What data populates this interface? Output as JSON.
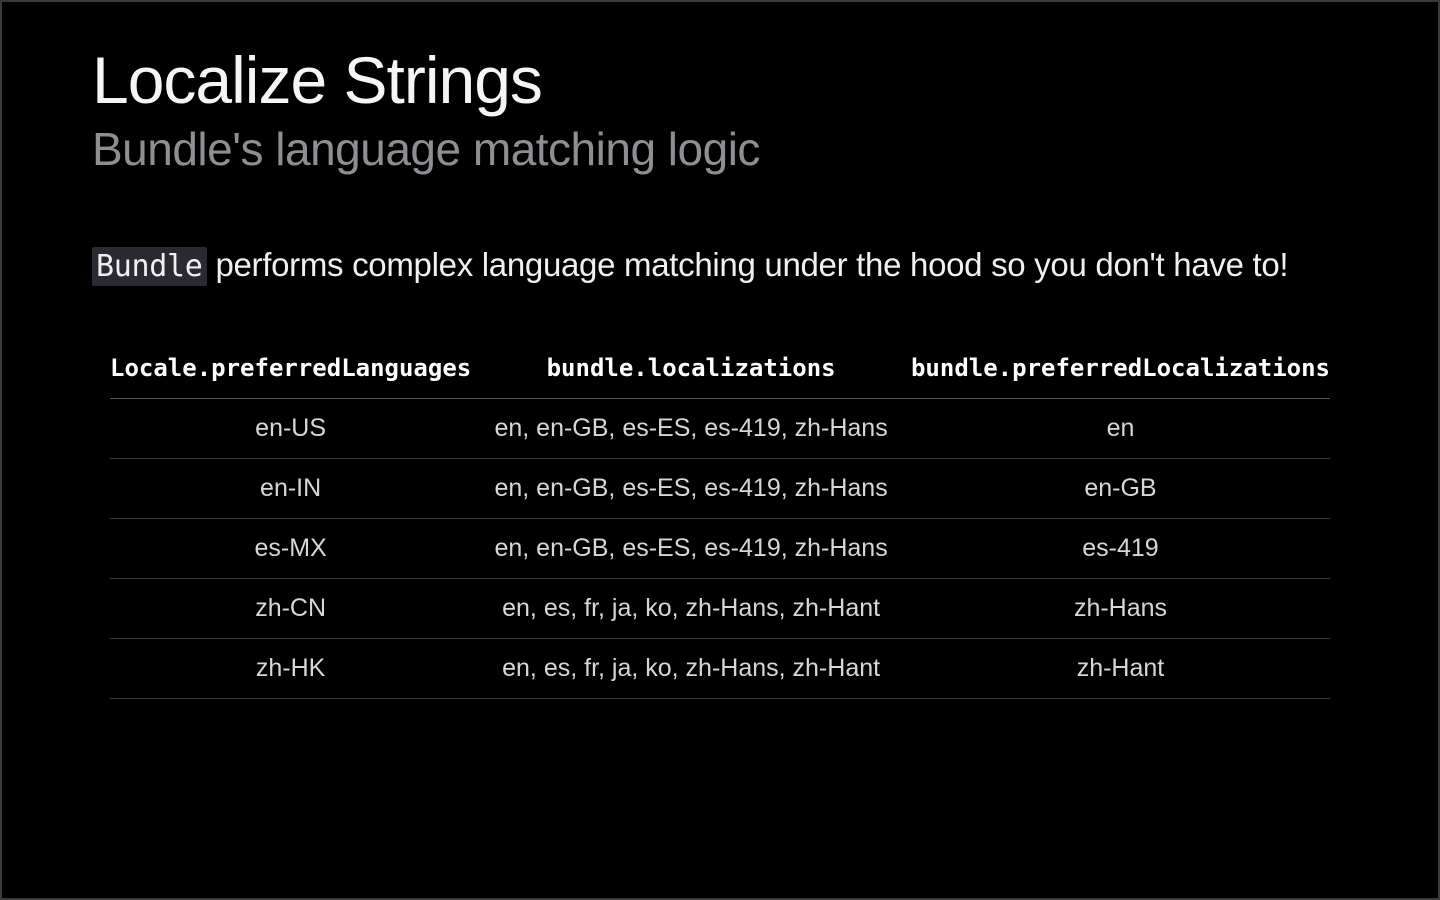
{
  "slide": {
    "title": "Localize Strings",
    "subtitle": "Bundle's language matching logic",
    "description_code": "Bundle",
    "description_rest": " performs complex language matching under the hood so you don't have to!",
    "table": {
      "headers": {
        "col1": "Locale.preferredLanguages",
        "col2": "bundle.localizations",
        "col3": "bundle.preferredLocalizations"
      },
      "rows": [
        {
          "c1": "en-US",
          "c2": "en, en-GB, es-ES, es-419, zh-Hans",
          "c3": "en"
        },
        {
          "c1": "en-IN",
          "c2": "en, en-GB, es-ES, es-419, zh-Hans",
          "c3": "en-GB"
        },
        {
          "c1": "es-MX",
          "c2": "en, en-GB, es-ES, es-419, zh-Hans",
          "c3": "es-419"
        },
        {
          "c1": "zh-CN",
          "c2": "en, es, fr, ja, ko, zh-Hans, zh-Hant",
          "c3": "zh-Hans"
        },
        {
          "c1": "zh-HK",
          "c2": "en, es, fr, ja, ko, zh-Hans, zh-Hant",
          "c3": "zh-Hant"
        }
      ]
    }
  }
}
